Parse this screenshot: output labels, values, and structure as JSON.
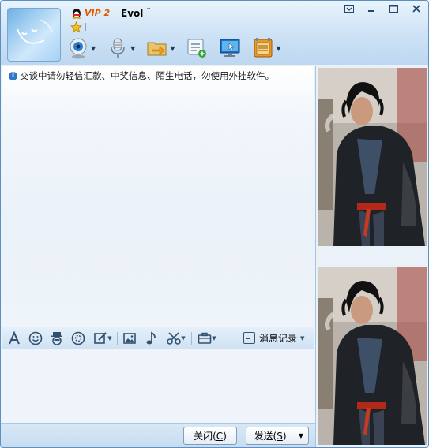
{
  "header": {
    "vip_label": "VIP 2",
    "nickname": "Evol",
    "nickname_mark": "ˇ"
  },
  "window_buttons": {
    "menu": "▣",
    "minimize": "—",
    "maximize": "□",
    "close": "✕"
  },
  "toolbar": {
    "items": [
      "video-call",
      "voice-call",
      "send-file",
      "create-discussion-group",
      "remote-assistance",
      "application-box"
    ]
  },
  "chat": {
    "notice": "交谈中请勿轻信汇款、中奖信息、陌生电话，勿使用外挂软件。"
  },
  "format_bar": {
    "history_label": "消息记录"
  },
  "buttons": {
    "close_label": "关闭(",
    "close_key": "C",
    "close_end": ")",
    "send_label": "发送(",
    "send_key": "S",
    "send_end": ")"
  },
  "colors": {
    "accent": "#2f77c6",
    "border": "#5d8fbf",
    "vip": "#e25a00"
  }
}
